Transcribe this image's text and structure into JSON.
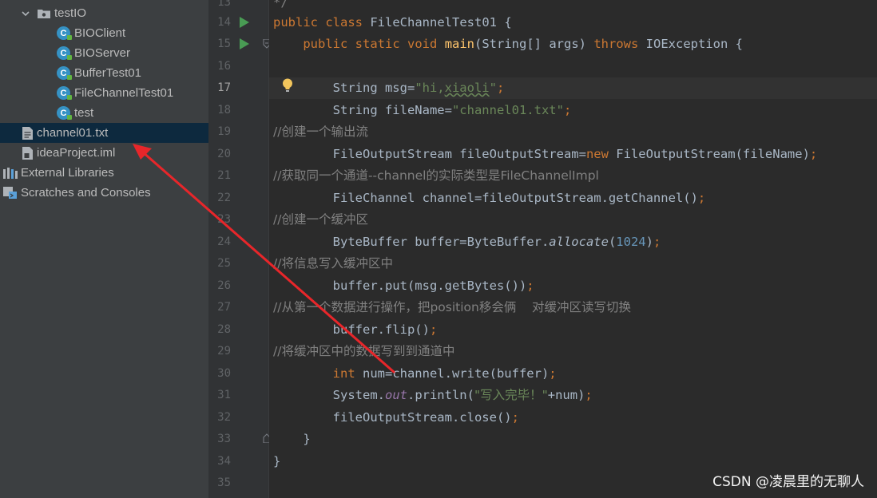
{
  "project_tree": {
    "items": [
      {
        "label": "testIO",
        "kind": "folder",
        "expanded": true
      },
      {
        "label": "BIOClient",
        "kind": "class"
      },
      {
        "label": "BIOServer",
        "kind": "class"
      },
      {
        "label": "BufferTest01",
        "kind": "class"
      },
      {
        "label": "FileChannelTest01",
        "kind": "class"
      },
      {
        "label": "test",
        "kind": "class"
      },
      {
        "label": "channel01.txt",
        "kind": "file",
        "selected": true
      },
      {
        "label": "ideaProject.iml",
        "kind": "file"
      },
      {
        "label": "External Libraries",
        "kind": "libraries"
      },
      {
        "label": "Scratches and Consoles",
        "kind": "scratches"
      }
    ]
  },
  "gutter": {
    "line_numbers": [
      "14",
      "15",
      "16",
      "17",
      "18",
      "19",
      "20",
      "21",
      "22",
      "23",
      "24",
      "25",
      "26",
      "27",
      "28",
      "29",
      "30",
      "31",
      "32",
      "33",
      "34",
      "35"
    ],
    "current_line": "17",
    "run_icon_lines": [
      "14",
      "15"
    ]
  },
  "editor": {
    "partial_top": "*/",
    "lines": {
      "l14": {
        "kw1": "public",
        "kw2": "class",
        "name": " FileChannelTest01 {"
      },
      "l15": {
        "kw1": "public",
        "kw2": "static",
        "kw3": "void",
        "fn": "main",
        "params": "(String[] args) ",
        "kw4": "throws",
        "rest": " IOException {"
      },
      "l17": {
        "pre": "String msg=",
        "s1": "\"hi,",
        "s2": "xiaoli",
        "s3": "\"",
        "end": ";"
      },
      "l18": {
        "pre": "String fileName=",
        "str": "\"channel01.txt\"",
        "end": ";"
      },
      "l19": {
        "comment": "//创建一个输出流"
      },
      "l20": {
        "pre": "FileOutputStream fileOutputStream=",
        "kw": "new",
        "rest": " FileOutputStream(fileName)",
        "end": ";"
      },
      "l21": {
        "comment": "//获取同一个通道--channel的实际类型是FileChannelImpl"
      },
      "l22": {
        "pre": "FileChannel channel=fileOutputStream.getChannel()",
        "end": ";"
      },
      "l23": {
        "comment": "//创建一个缓冲区"
      },
      "l24": {
        "pre": "ByteBuffer buffer=ByteBuffer.",
        "method": "allocate",
        "open": "(",
        "num": "1024",
        "close": ")",
        "end": ";"
      },
      "l25": {
        "comment": "//将信息写入缓冲区中"
      },
      "l26": {
        "pre": "buffer.put(msg.getBytes())",
        "end": ";"
      },
      "l27": {
        "comment": "//从第一个数据进行操作，把position移会俩    对缓冲区读写切换"
      },
      "l28": {
        "pre": "buffer.flip()",
        "end": ";"
      },
      "l29": {
        "comment": "//将缓冲区中的数据写到到通道中"
      },
      "l30": {
        "kw": "int",
        "rest": " num=channel.write(buffer)",
        "end": ";"
      },
      "l31": {
        "pre": "System.",
        "field": "out",
        "mid": ".println(",
        "str": "\"写入完毕！\"",
        "rest": "+num)",
        "end": ";"
      },
      "l32": {
        "pre": "fileOutputStream.close()",
        "end": ";"
      },
      "l33": {
        "brace": "}"
      },
      "l34": {
        "brace": "}"
      }
    }
  },
  "watermark": "CSDN @凌晨里的无聊人",
  "colors": {
    "background": "#2b2b2b",
    "sidebar": "#3c3f41",
    "selection": "#0d293e",
    "keyword": "#cc7832",
    "string": "#6a8759",
    "number": "#6897bb",
    "method": "#ffc66d",
    "comment": "#808080",
    "annotation_arrow": "#e8262a"
  }
}
